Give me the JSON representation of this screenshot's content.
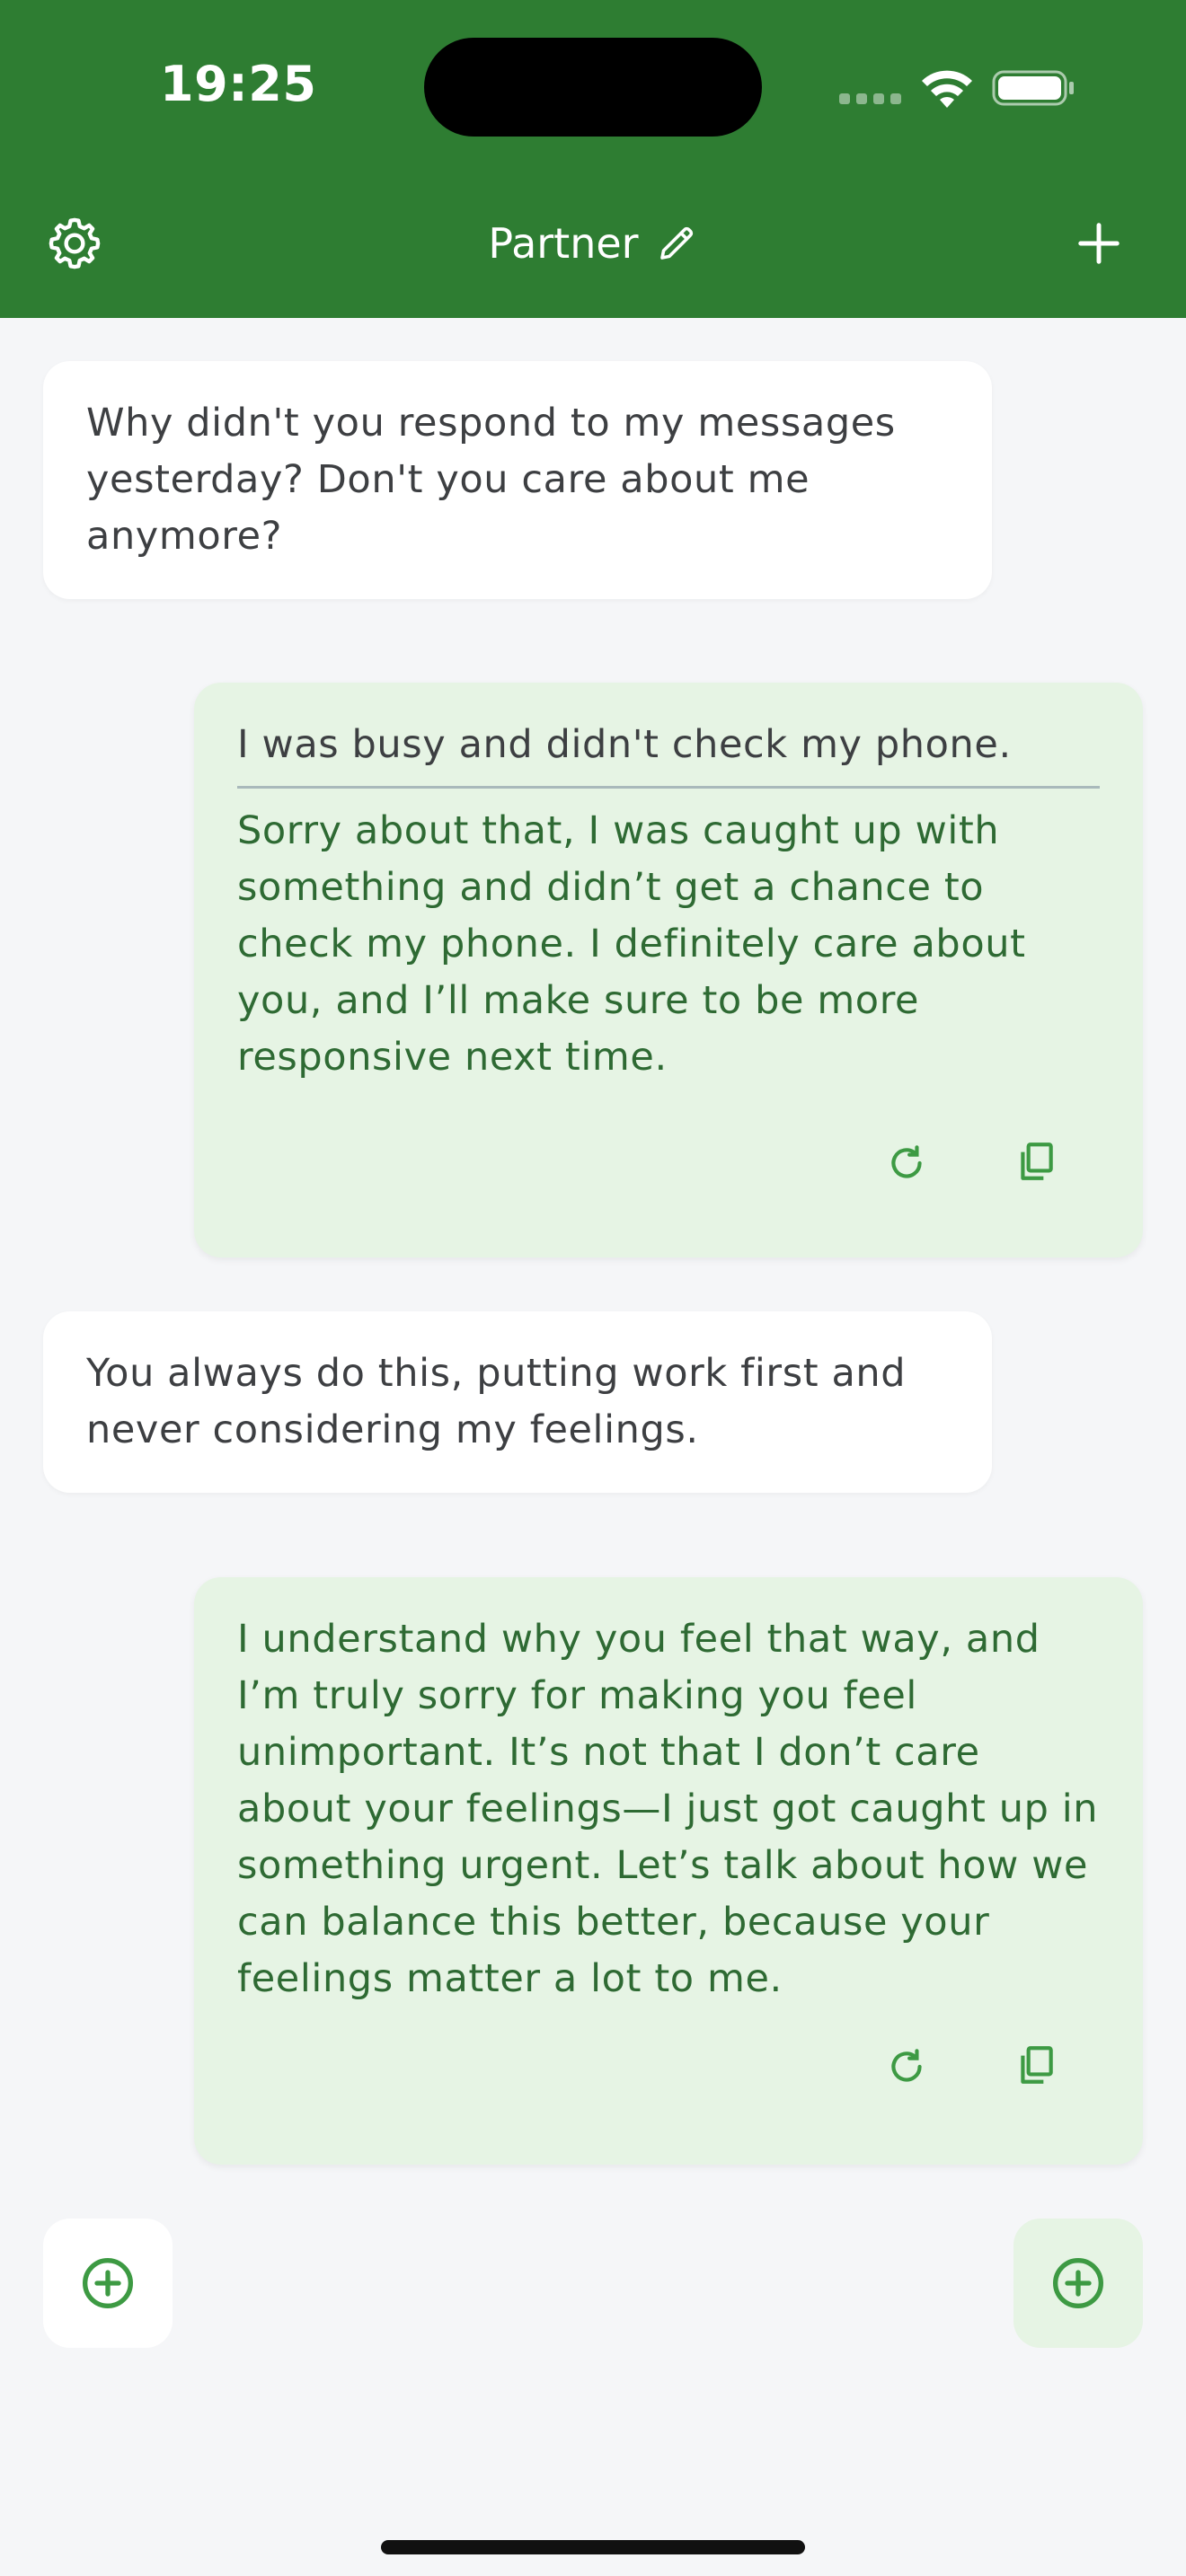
{
  "status_bar": {
    "time": "19:25"
  },
  "nav": {
    "title": "Partner",
    "settings_icon": "gear-icon",
    "edit_icon": "pencil-icon",
    "add_icon": "plus-icon"
  },
  "colors": {
    "header": "#2e7d32",
    "incoming_bubble": "#ffffff",
    "outgoing_bubble": "#e6f4e4",
    "reply_text": "#2e6a33",
    "background": "#f5f6f8"
  },
  "messages": [
    {
      "role": "partner",
      "text": "Why didn't you respond to my messages yesterday? Don't you care about me anymore?"
    },
    {
      "role": "me",
      "prompt": "I was busy and didn't check my phone.",
      "reply": "Sorry about that, I was caught up with something and didn’t get a chance to check my phone. I definitely care about you, and I’ll make sure to be more responsive next time.",
      "actions": [
        "refresh-icon",
        "copy-icon"
      ]
    },
    {
      "role": "partner",
      "text": "You always do this, putting work first and never considering my feelings."
    },
    {
      "role": "me",
      "reply": "I understand why you feel that way, and I’m truly sorry for making you feel unimportant. It’s not that I don’t care about your feelings—I just got caught up in something urgent. Let’s talk about how we can balance this better, because your feelings matter a lot to me.",
      "actions": [
        "refresh-icon",
        "copy-icon"
      ]
    }
  ],
  "composer": {
    "add_partner_icon": "add-circle-icon",
    "add_me_icon": "add-circle-icon"
  }
}
